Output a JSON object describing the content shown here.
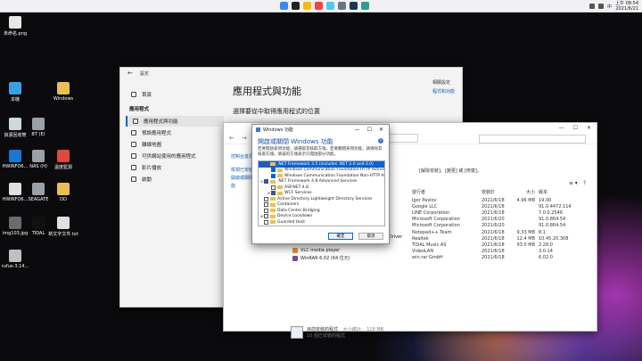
{
  "taskbar": {
    "tray_lang": "中",
    "time": "上午 08:54",
    "date": "2021/6/21",
    "icon_colors": [
      "#3a86ff",
      "#222222",
      "#ffb703",
      "#f94144",
      "#4cc9f0",
      "#6c757d",
      "#1d3557",
      "#2a9d8f"
    ]
  },
  "desktop": {
    "icons": [
      {
        "label": "未命名.png",
        "color": "#e6e6e6"
      },
      {
        "label": "本機",
        "color": "#3aa0e6"
      },
      {
        "label": "Windows",
        "color": "#e8bf50"
      },
      {
        "label": "資源回收筒",
        "color": "#cfd8dc"
      },
      {
        "label": "BT (E)",
        "color": "#9aa0a6"
      },
      {
        "label": "HWINFO6...",
        "color": "#1976d2"
      },
      {
        "label": "NAS (H)",
        "color": "#9aa0a6"
      },
      {
        "label": "溫度監測",
        "color": "#e0483c"
      },
      {
        "label": "HWINFO6...",
        "color": "#e0e0e0"
      },
      {
        "label": "SEAGATE",
        "color": "#9aa0a6"
      },
      {
        "label": "DD",
        "color": "#e8bf50"
      },
      {
        "label": "img103.jpg",
        "color": "#6b6b6b"
      },
      {
        "label": "TIDAL",
        "color": "#111111"
      },
      {
        "label": "新文字文件.txt",
        "color": "#e0e0e0"
      },
      {
        "label": "rufus-3.14...",
        "color": "#c0c0c0"
      }
    ]
  },
  "settings": {
    "window_title": "設定",
    "home": "首頁",
    "nav_header": "應用程式",
    "nav": [
      "應用程式與功能",
      "預設應用程式",
      "離線地圖",
      "可供網站使用的應用程式",
      "影片播放",
      "啟動"
    ],
    "page_title": "應用程式與功能",
    "subtitle": "選擇要從中取得應用程式的位置",
    "related_label": "相關設定",
    "related_link": "程式和功能"
  },
  "control_panel": {
    "side_home": "控制台首頁",
    "side_updates": "檢視已安裝的更新",
    "side_features": "開啟或關閉 Windows 功能",
    "notice": "[解除安裝]、[變更] 或 [修復]。",
    "columns": [
      "發行者",
      "安裝於",
      "大小",
      "版本"
    ],
    "rows": [
      {
        "publisher": "Igor Pavlov",
        "date": "2021/6/18",
        "size": "4.96 MB",
        "version": "19.00"
      },
      {
        "publisher": "Google LLC",
        "date": "2021/6/18",
        "size": "",
        "version": "91.0.4472.114"
      },
      {
        "publisher": "LINE Corporation",
        "date": "2021/6/18",
        "size": "",
        "version": "7.0.0.2546"
      },
      {
        "publisher": "Microsoft Corporation",
        "date": "2021/6/20",
        "size": "",
        "version": "91.0.864.54"
      },
      {
        "publisher": "Microsoft Corporation",
        "date": "2021/6/20",
        "size": "",
        "version": "91.0.864.54"
      },
      {
        "publisher": "Notepad++ Team",
        "date": "2021/6/18",
        "size": "9.33 MB",
        "version": "8.1"
      },
      {
        "publisher": "Realtek",
        "date": "2021/6/18",
        "size": "12.4 MB",
        "version": "10.45.20.308"
      },
      {
        "publisher": "TIDAL Music AS",
        "date": "2021/6/18",
        "size": "93.0 MB",
        "version": "2.28.0"
      },
      {
        "publisher": "VideoLAN",
        "date": "2021/6/18",
        "size": "",
        "version": "3.0.14"
      },
      {
        "publisher": "win.rar GmbH",
        "date": "2021/6/18",
        "size": "",
        "version": "6.02.0"
      }
    ],
    "partial_program": "Audio Driver",
    "programs": [
      {
        "name": "VLC media player",
        "color": "#f28c28"
      },
      {
        "name": "WinRAR 6.02 (64 位元)",
        "color": "#7b4aa6"
      }
    ],
    "status_label": "目前安裝的程式",
    "status_size": "大小總計：   119 MB",
    "status_count": "10 個已安裝的程式"
  },
  "features": {
    "title": "Windows 功能",
    "heading": "開啟或關閉 Windows 功能",
    "help": "?",
    "description": "若要開啟某項功能，請選取其核取方塊。若要關閉某項功能，請清除其核取方塊。填滿的方塊表示只開啟部分功能。",
    "tree": [
      {
        "label": ".NET Framework 3.5 (includes .NET 2.0 and 3.0)",
        "indent": 0,
        "expander": "⊟",
        "check": "part",
        "selected": true
      },
      {
        "label": "Windows Communication Foundation HTTP Activatio",
        "indent": 1,
        "expander": "",
        "check": "on",
        "selected": false
      },
      {
        "label": "Windows Communication Foundation Non-HTTP Acti",
        "indent": 1,
        "expander": "",
        "check": "on",
        "selected": false
      },
      {
        "label": ".NET Framework 4.8 Advanced Services",
        "indent": 0,
        "expander": "⊟",
        "check": "part",
        "selected": false
      },
      {
        "label": "ASP.NET 4.8",
        "indent": 1,
        "expander": "",
        "check": "off",
        "selected": false
      },
      {
        "label": "WCF Services",
        "indent": 1,
        "expander": "⊞",
        "check": "part",
        "selected": false
      },
      {
        "label": "Active Directory Lightweight Directory Services",
        "indent": 0,
        "expander": "",
        "check": "off",
        "selected": false
      },
      {
        "label": "Containers",
        "indent": 0,
        "expander": "",
        "check": "off",
        "selected": false
      },
      {
        "label": "Data Center Bridging",
        "indent": 0,
        "expander": "",
        "check": "off",
        "selected": false
      },
      {
        "label": "Device Lockdown",
        "indent": 0,
        "expander": "⊞",
        "check": "off",
        "selected": false
      },
      {
        "label": "Guarded Host",
        "indent": 0,
        "expander": "",
        "check": "off",
        "selected": false
      }
    ],
    "ok": "確定",
    "cancel": "取消"
  }
}
